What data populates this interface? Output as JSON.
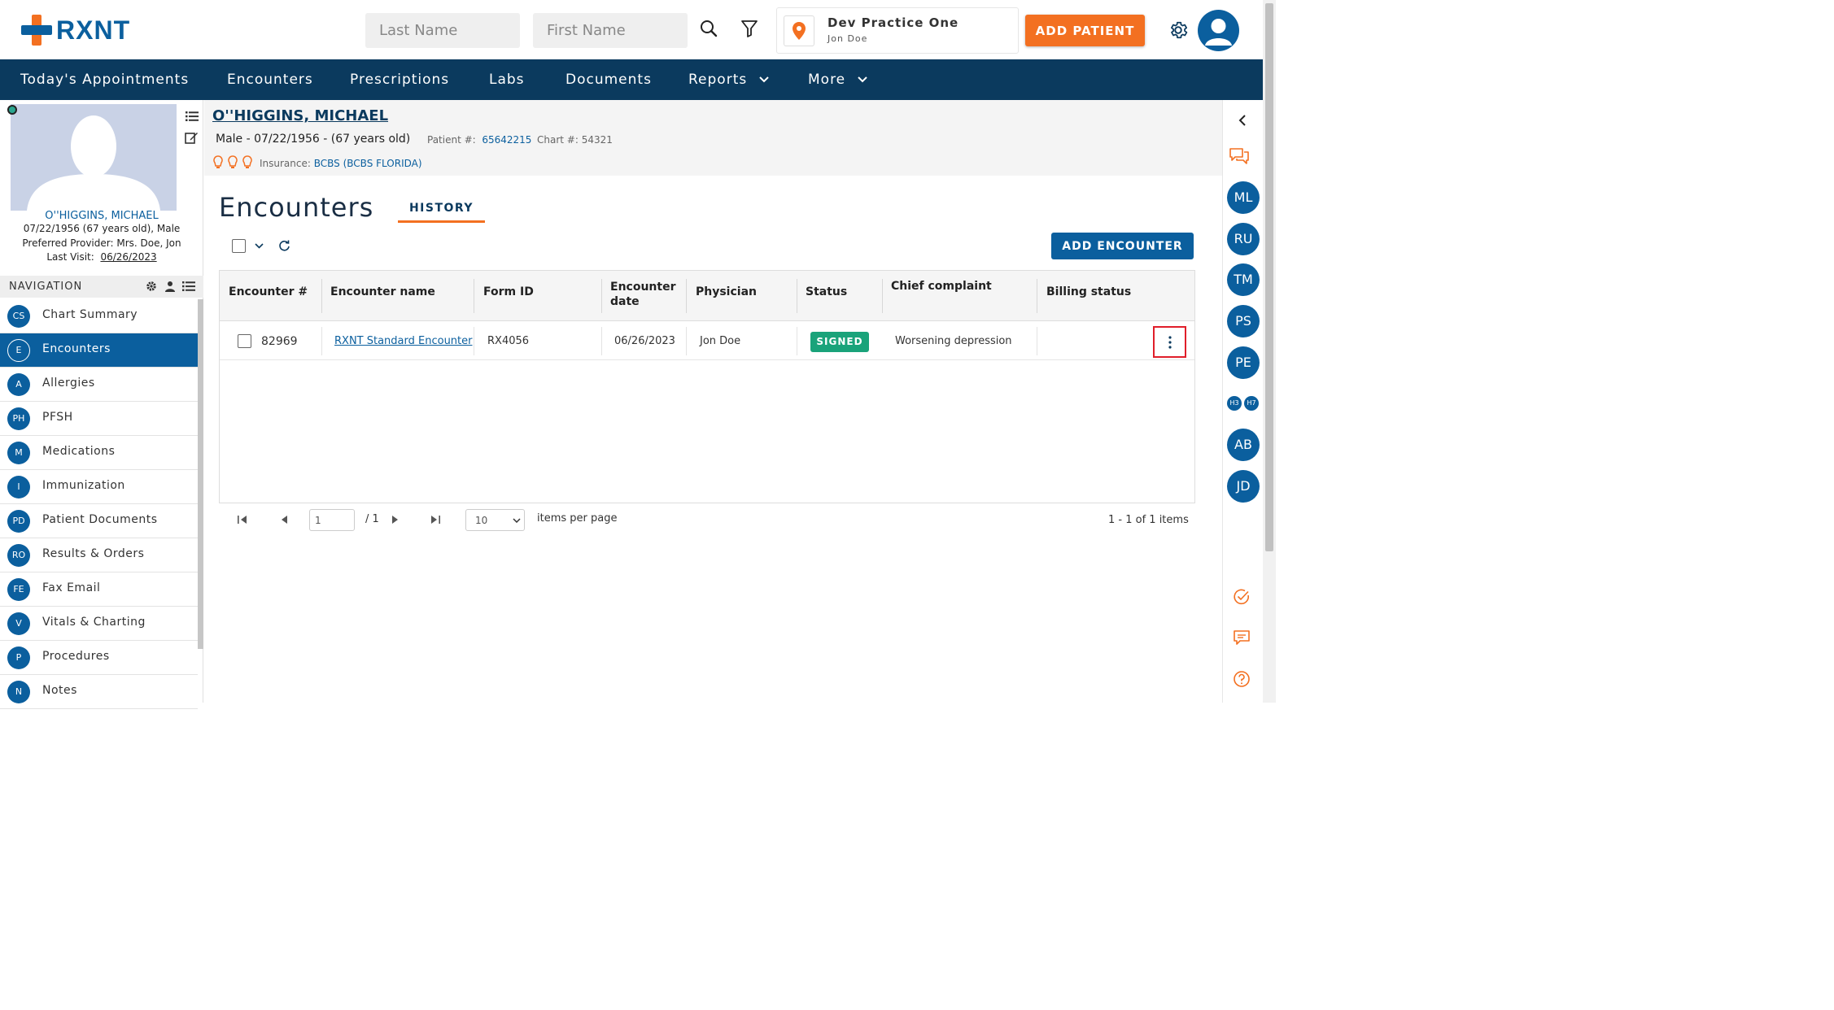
{
  "brand": {
    "name": "RXNT"
  },
  "header": {
    "last_name_placeholder": "Last Name",
    "first_name_placeholder": "First Name",
    "practice_name": "Dev Practice One",
    "practice_user": "Jon Doe",
    "add_patient_label": "ADD PATIENT"
  },
  "nav": {
    "items": [
      "Today's Appointments",
      "Encounters",
      "Prescriptions",
      "Labs",
      "Documents",
      "Reports",
      "More"
    ]
  },
  "patient": {
    "name": "O''HIGGINS, MICHAEL",
    "demographics": "Male - 07/22/1956 - (67 years old)",
    "patient_num_label": "Patient #:",
    "patient_num": "65642215",
    "chart_label": "Chart #:",
    "chart_num": "54321",
    "insurance_label": "Insurance:",
    "insurance": "BCBS (BCBS FLORIDA)",
    "card_name": "O''HIGGINS, MICHAEL",
    "card_dob": "07/22/1956 (67 years old), Male",
    "card_provider": "Preferred Provider: Mrs. Doe, Jon",
    "card_last_visit_label": "Last Visit:",
    "card_last_visit": "06/26/2023"
  },
  "sidebar": {
    "header": "NAVIGATION",
    "items": [
      {
        "badge": "CS",
        "label": "Chart Summary"
      },
      {
        "badge": "E",
        "label": "Encounters"
      },
      {
        "badge": "A",
        "label": "Allergies"
      },
      {
        "badge": "PH",
        "label": "PFSH"
      },
      {
        "badge": "M",
        "label": "Medications"
      },
      {
        "badge": "I",
        "label": "Immunization"
      },
      {
        "badge": "PD",
        "label": "Patient Documents"
      },
      {
        "badge": "RO",
        "label": "Results & Orders"
      },
      {
        "badge": "FE",
        "label": "Fax Email"
      },
      {
        "badge": "V",
        "label": "Vitals & Charting"
      },
      {
        "badge": "P",
        "label": "Procedures"
      },
      {
        "badge": "N",
        "label": "Notes"
      }
    ],
    "active_index": 1
  },
  "main": {
    "title": "Encounters",
    "tab_history": "HISTORY",
    "add_encounter_label": "ADD ENCOUNTER",
    "columns": [
      "Encounter #",
      "Encounter name",
      "Form ID",
      "Encounter date",
      "Physician",
      "Status",
      "Chief complaint",
      "Billing status"
    ],
    "rows": [
      {
        "encounter_num": "82969",
        "encounter_name": "RXNT Standard Encounter",
        "form_id": "RX4056",
        "date": "06/26/2023",
        "physician": "Jon Doe",
        "status": "SIGNED",
        "chief_complaint": "Worsening depression",
        "billing_status": ""
      }
    ]
  },
  "pager": {
    "page": "1",
    "of_pages": "/ 1",
    "per_page": "10",
    "per_page_label": "items per page",
    "summary": "1 - 1 of 1 items"
  },
  "rail": {
    "avatars": [
      "ML",
      "RU",
      "TM",
      "PS",
      "PE"
    ],
    "small_avatars": [
      "H3",
      "H7"
    ],
    "avatars_bottom": [
      "AB",
      "JD"
    ]
  },
  "colors": {
    "primary": "#0b5f9e",
    "navbar": "#0b3a5e",
    "accent": "#f37021",
    "signed": "#1aa37a"
  }
}
